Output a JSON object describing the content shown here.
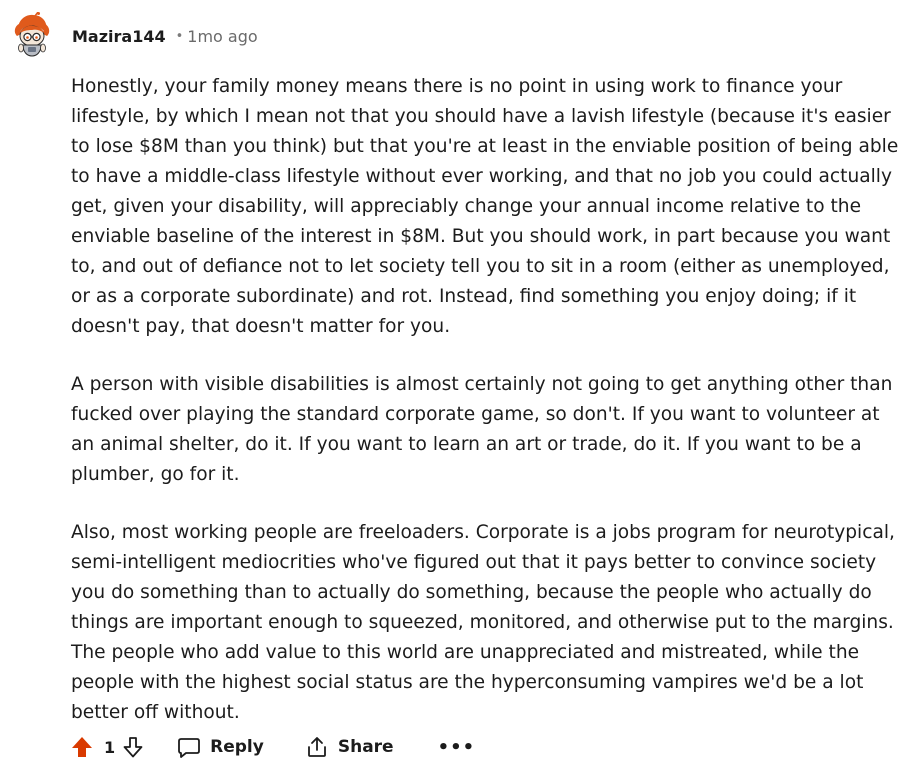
{
  "comment": {
    "author": "Mazira144",
    "separator": "•",
    "time": "1mo ago",
    "avatar_icon": "snoo-avatar-icon",
    "paragraphs": [
      "Honestly, your family money means there is no point in using work to finance your lifestyle, by which I mean not that you should have a lavish lifestyle (because it's easier to lose $8M than you think) but that you're at least in the enviable position of being able to have a middle-class lifestyle without ever working, and that no job you could actually get, given your disability, will appreciably change your annual income relative to the enviable baseline of the interest in $8M. But you should work, in part because you want to, and out of defiance not to let society tell you to sit in a room (either as unemployed, or as a corporate subordinate) and rot. Instead, find something you enjoy doing; if it doesn't pay, that doesn't matter for you.",
      "A person with visible disabilities is almost certainly not going to get anything other than fucked over playing the standard corporate game, so don't. If you want to volunteer at an animal shelter, do it. If you want to learn an art or trade, do it. If you want to be a plumber, go for it.",
      "Also, most working people are freeloaders. Corporate is a jobs program for neurotypical, semi-intelligent mediocrities who've figured out that it pays better to convince society you do something than to actually do something, because the people who actually do things are important enough to squeezed, monitored, and otherwise put to the margins. The people who add value to this world are unappreciated and mistreated, while the people with the highest social status are the hyperconsuming vampires we'd be a lot better off without."
    ]
  },
  "actions": {
    "score": "1",
    "upvote_icon": "upvote-arrow-icon",
    "upvote_color": "#d93a00",
    "downvote_icon": "downvote-arrow-icon",
    "reply_label": "Reply",
    "reply_icon": "speech-bubble-icon",
    "share_label": "Share",
    "share_icon": "share-icon",
    "more_label": "•••",
    "more_icon": "more-options-icon"
  }
}
